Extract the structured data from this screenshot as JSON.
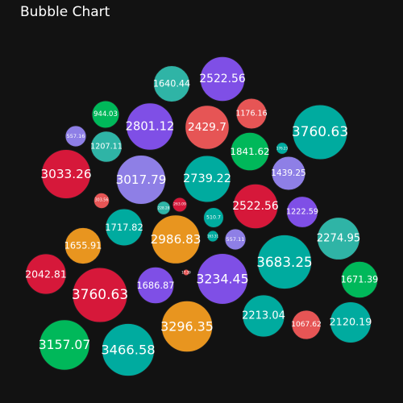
{
  "chart_data": {
    "type": "bubble",
    "title": "Bubble Chart",
    "colors": {
      "purple": "#7f4fe6",
      "lavender": "#8e7fe6",
      "teal": "#00ab9f",
      "teal_light": "#2fb4a6",
      "red": "#e65555",
      "crimson": "#d6183a",
      "green": "#00b85a",
      "orange": "#e8951f"
    },
    "bubbles": [
      {
        "value": 1640.44,
        "label": "1640.44",
        "color": "#2fb4a6"
      },
      {
        "value": 2522.56,
        "label": "2522.56",
        "color": "#7f4fe6"
      },
      {
        "value": 944.03,
        "label": "944.03",
        "color": "#00b85a"
      },
      {
        "value": 2801.12,
        "label": "2801.12",
        "color": "#7f4fe6"
      },
      {
        "value": 2429.7,
        "label": "2429.7",
        "color": "#e65555"
      },
      {
        "value": 1176.16,
        "label": "1176.16",
        "color": "#e65555"
      },
      {
        "value": 3760.63,
        "label": "3760.63",
        "color": "#00ab9f"
      },
      {
        "value": 557.16,
        "label": "557.16",
        "color": "#8e7fe6"
      },
      {
        "value": 1207.11,
        "label": "1207.11",
        "color": "#2fb4a6"
      },
      {
        "value": 1841.62,
        "label": "1841.62",
        "color": "#00b85a"
      },
      {
        "value": 176.23,
        "label": "176.23",
        "color": "#00ab9f"
      },
      {
        "value": 3033.26,
        "label": "3033.26",
        "color": "#d6183a"
      },
      {
        "value": 3017.79,
        "label": "3017.79",
        "color": "#8e7fe6"
      },
      {
        "value": 2739.22,
        "label": "2739.22",
        "color": "#00ab9f"
      },
      {
        "value": 1439.25,
        "label": "1439.25",
        "color": "#8e7fe6"
      },
      {
        "value": 303.56,
        "label": "303.56",
        "color": "#e65555"
      },
      {
        "value": 228.28,
        "label": "228.28",
        "color": "#2fb4a6"
      },
      {
        "value": 263.09,
        "label": "263.09",
        "color": "#d6183a"
      },
      {
        "value": 2522.56,
        "label": "2522.56",
        "color": "#d6183a"
      },
      {
        "value": 1222.59,
        "label": "1222.59",
        "color": "#7f4fe6"
      },
      {
        "value": 1717.82,
        "label": "1717.82",
        "color": "#00ab9f"
      },
      {
        "value": 510.7,
        "label": "510.7",
        "color": "#00ab9f"
      },
      {
        "value": 2274.95,
        "label": "2274.95",
        "color": "#2fb4a6"
      },
      {
        "value": 1655.91,
        "label": "1655.91",
        "color": "#e8951f"
      },
      {
        "value": 2986.83,
        "label": "2986.83",
        "color": "#e8951f"
      },
      {
        "value": 163.31,
        "label": "163.31",
        "color": "#00ab9f"
      },
      {
        "value": 557.11,
        "label": "557.11",
        "color": "#8e7fe6"
      },
      {
        "value": 3683.25,
        "label": "3683.25",
        "color": "#00ab9f"
      },
      {
        "value": 2042.81,
        "label": "2042.81",
        "color": "#d6183a"
      },
      {
        "value": 17.39,
        "label": "17.39",
        "color": "#e65555"
      },
      {
        "value": 1671.39,
        "label": "1671.39",
        "color": "#00b85a"
      },
      {
        "value": 3760.63,
        "label": "3760.63",
        "color": "#d6183a"
      },
      {
        "value": 1686.87,
        "label": "1686.87",
        "color": "#7f4fe6"
      },
      {
        "value": 3234.45,
        "label": "3234.45",
        "color": "#7f4fe6"
      },
      {
        "value": 2213.04,
        "label": "2213.04",
        "color": "#00ab9f"
      },
      {
        "value": 3296.35,
        "label": "3296.35",
        "color": "#e8951f"
      },
      {
        "value": 1067.62,
        "label": "1067.62",
        "color": "#e65555"
      },
      {
        "value": 2120.19,
        "label": "2120.19",
        "color": "#00ab9f"
      },
      {
        "value": 3157.07,
        "label": "3157.07",
        "color": "#00b85a"
      },
      {
        "value": 3466.58,
        "label": "3466.58",
        "color": "#00ab9f"
      }
    ]
  }
}
